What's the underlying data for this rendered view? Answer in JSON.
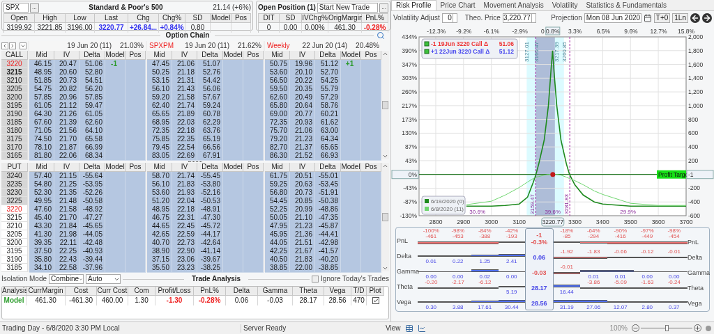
{
  "quote": {
    "symbol": "SPX",
    "browse": "...",
    "title": "Standard & Poor's 500",
    "iv": "21.14 (+6%)",
    "columns": [
      "Open",
      "High",
      "Low",
      "Last",
      "Chg",
      "Chg%",
      "SD",
      "Model",
      "Pos"
    ],
    "values": [
      {
        "text": "3199.92"
      },
      {
        "text": "3221.85"
      },
      {
        "text": "3196.00"
      },
      {
        "text": "3220.77",
        "color": "#3333ee"
      },
      {
        "text": "+26.84...",
        "color": "#3333ee"
      },
      {
        "text": "+0.84%",
        "color": "#3333ee"
      },
      {
        "text": "0.80"
      }
    ]
  },
  "open_position": {
    "title": "Open Position (1)",
    "trade": "Start New Trade",
    "browse": "...",
    "columns": [
      "DIT",
      "SD",
      "IVChg%",
      "OrigMargin",
      "PnL%"
    ],
    "values": [
      {
        "text": "0"
      },
      {
        "text": "0.00"
      },
      {
        "text": "0.00%"
      },
      {
        "text": "461.30"
      },
      {
        "text": "-0.28%",
        "color": "#ee2222"
      }
    ]
  },
  "option_chain": {
    "title": "Option Chain",
    "expirations": [
      {
        "date": "19 Jun 20 (11)",
        "iv": "21.03%"
      },
      {
        "tag": "SPXPM",
        "date": "19 Jun 20 (11)",
        "iv": "21.62%"
      },
      {
        "tag": "Weekly",
        "date": "22 Jun 20 (14)",
        "iv": "20.48%"
      }
    ],
    "calls": {
      "header": "CALL",
      "columns": [
        "Mid",
        "IV",
        "Delta",
        "Model",
        "Pos",
        "Mid",
        "IV",
        "Delta",
        "Model",
        "Pos",
        "Mid",
        "IV",
        "Delta",
        "Model",
        "Pos"
      ],
      "rows": [
        {
          "strike": "3220",
          "itm": true,
          "atm": true,
          "bold": false,
          "cells": [
            "46.15",
            "20.47",
            "51.06",
            "-1",
            "",
            "47.45",
            "21.06",
            "51.07",
            "",
            "",
            "50.75",
            "19.96",
            "51.12",
            "+1",
            ""
          ]
        },
        {
          "strike": "3215",
          "itm": true,
          "atm": false,
          "bold": true,
          "cells": [
            "48.95",
            "20.60",
            "52.80",
            "",
            "",
            "50.25",
            "21.18",
            "52.76",
            "",
            "",
            "53.60",
            "20.10",
            "52.70",
            "",
            ""
          ]
        },
        {
          "strike": "3210",
          "itm": true,
          "atm": false,
          "bold": false,
          "cells": [
            "51.85",
            "20.73",
            "54.51",
            "",
            "",
            "53.15",
            "21.31",
            "54.42",
            "",
            "",
            "56.50",
            "20.22",
            "54.25",
            "",
            ""
          ]
        },
        {
          "strike": "3205",
          "itm": true,
          "atm": false,
          "bold": false,
          "cells": [
            "54.75",
            "20.82",
            "56.20",
            "",
            "",
            "56.10",
            "21.43",
            "56.06",
            "",
            "",
            "59.50",
            "20.35",
            "55.79",
            "",
            ""
          ]
        },
        {
          "strike": "3200",
          "itm": true,
          "atm": false,
          "bold": false,
          "cells": [
            "57.85",
            "20.96",
            "57.85",
            "",
            "",
            "59.20",
            "21.58",
            "57.67",
            "",
            "",
            "62.60",
            "20.49",
            "57.29",
            "",
            ""
          ]
        },
        {
          "strike": "3195",
          "itm": true,
          "atm": false,
          "bold": false,
          "cells": [
            "61.05",
            "21.12",
            "59.47",
            "",
            "",
            "62.40",
            "21.74",
            "59.24",
            "",
            "",
            "65.80",
            "20.64",
            "58.76",
            "",
            ""
          ]
        },
        {
          "strike": "3190",
          "itm": true,
          "atm": false,
          "bold": false,
          "cells": [
            "64.30",
            "21.26",
            "61.05",
            "",
            "",
            "65.65",
            "21.89",
            "60.78",
            "",
            "",
            "69.00",
            "20.77",
            "60.21",
            "",
            ""
          ]
        },
        {
          "strike": "3185",
          "itm": true,
          "atm": false,
          "bold": false,
          "cells": [
            "67.60",
            "21.39",
            "62.60",
            "",
            "",
            "68.95",
            "22.03",
            "62.29",
            "",
            "",
            "72.35",
            "20.93",
            "61.62",
            "",
            ""
          ]
        },
        {
          "strike": "3180",
          "itm": true,
          "atm": false,
          "bold": false,
          "cells": [
            "71.05",
            "21.56",
            "64.10",
            "",
            "",
            "72.35",
            "22.18",
            "63.76",
            "",
            "",
            "75.70",
            "21.06",
            "63.00",
            "",
            ""
          ]
        },
        {
          "strike": "3175",
          "itm": true,
          "atm": false,
          "bold": false,
          "cells": [
            "74.50",
            "21.70",
            "65.58",
            "",
            "",
            "75.85",
            "22.35",
            "65.19",
            "",
            "",
            "79.20",
            "21.23",
            "64.34",
            "",
            ""
          ]
        },
        {
          "strike": "3170",
          "itm": true,
          "atm": false,
          "bold": false,
          "cells": [
            "78.10",
            "21.87",
            "66.99",
            "",
            "",
            "79.45",
            "22.54",
            "66.56",
            "",
            "",
            "82.70",
            "21.37",
            "65.65",
            "",
            ""
          ]
        },
        {
          "strike": "3165",
          "itm": true,
          "atm": false,
          "bold": false,
          "cells": [
            "81.80",
            "22.06",
            "68.34",
            "",
            "",
            "83.05",
            "22.69",
            "67.91",
            "",
            "",
            "86.30",
            "21.52",
            "66.93",
            "",
            ""
          ]
        }
      ]
    },
    "puts": {
      "header": "PUT",
      "columns": [
        "Mid",
        "IV",
        "Delta",
        "Model",
        "Pos",
        "Mid",
        "IV",
        "Delta",
        "Model",
        "Pos",
        "Mid",
        "IV",
        "Delta",
        "Model",
        "Pos"
      ],
      "rows": [
        {
          "strike": "3240",
          "itm": true,
          "atm": false,
          "bold": false,
          "cells": [
            "57.40",
            "21.15",
            "-55.64",
            "",
            "",
            "58.70",
            "21.74",
            "-55.45",
            "",
            "",
            "61.75",
            "20.51",
            "-55.01",
            "",
            ""
          ]
        },
        {
          "strike": "3235",
          "itm": true,
          "atm": false,
          "bold": false,
          "cells": [
            "54.80",
            "21.25",
            "-53.95",
            "",
            "",
            "56.10",
            "21.83",
            "-53.80",
            "",
            "",
            "59.25",
            "20.63",
            "-53.45",
            "",
            ""
          ]
        },
        {
          "strike": "3230",
          "itm": true,
          "atm": false,
          "bold": false,
          "cells": [
            "52.30",
            "21.35",
            "-52.26",
            "",
            "",
            "53.60",
            "21.93",
            "-52.16",
            "",
            "",
            "56.80",
            "20.73",
            "-51.91",
            "",
            ""
          ]
        },
        {
          "strike": "3225",
          "itm": true,
          "atm": false,
          "bold": false,
          "cells": [
            "49.95",
            "21.48",
            "-50.58",
            "",
            "",
            "51.20",
            "22.04",
            "-50.53",
            "",
            "",
            "54.45",
            "20.85",
            "-50.38",
            "",
            ""
          ]
        },
        {
          "strike": "3220",
          "itm": false,
          "atm": true,
          "bold": false,
          "cells": [
            "47.60",
            "21.58",
            "-48.92",
            "",
            "",
            "48.95",
            "22.18",
            "-48.91",
            "",
            "",
            "52.25",
            "20.99",
            "-48.86",
            "",
            ""
          ]
        },
        {
          "strike": "3215",
          "itm": false,
          "atm": false,
          "bold": false,
          "cells": [
            "45.40",
            "21.70",
            "-47.27",
            "",
            "",
            "46.75",
            "22.31",
            "-47.30",
            "",
            "",
            "50.05",
            "21.10",
            "-47.35",
            "",
            ""
          ]
        },
        {
          "strike": "3210",
          "itm": false,
          "atm": false,
          "bold": false,
          "cells": [
            "43.30",
            "21.84",
            "-45.65",
            "",
            "",
            "44.65",
            "22.45",
            "-45.72",
            "",
            "",
            "47.95",
            "21.23",
            "-45.87",
            "",
            ""
          ]
        },
        {
          "strike": "3205",
          "itm": false,
          "atm": false,
          "bold": false,
          "cells": [
            "41.30",
            "21.98",
            "-44.05",
            "",
            "",
            "42.65",
            "22.59",
            "-44.17",
            "",
            "",
            "45.95",
            "21.36",
            "-44.41",
            "",
            ""
          ]
        },
        {
          "strike": "3200",
          "itm": false,
          "atm": false,
          "bold": false,
          "cells": [
            "39.35",
            "22.11",
            "-42.48",
            "",
            "",
            "40.70",
            "22.73",
            "-42.64",
            "",
            "",
            "44.05",
            "21.51",
            "-42.98",
            "",
            ""
          ]
        },
        {
          "strike": "3195",
          "itm": false,
          "atm": false,
          "bold": false,
          "cells": [
            "37.50",
            "22.25",
            "-40.93",
            "",
            "",
            "38.90",
            "22.90",
            "-41.14",
            "",
            "",
            "42.25",
            "21.67",
            "-41.57",
            "",
            ""
          ]
        },
        {
          "strike": "3190",
          "itm": false,
          "atm": false,
          "bold": false,
          "cells": [
            "35.80",
            "22.43",
            "-39.44",
            "",
            "",
            "37.15",
            "23.06",
            "-39.67",
            "",
            "",
            "40.50",
            "21.83",
            "-40.20",
            "",
            ""
          ]
        },
        {
          "strike": "3185",
          "itm": false,
          "atm": false,
          "bold": false,
          "cells": [
            "34.10",
            "22.58",
            "-37.96",
            "",
            "",
            "35.50",
            "23.23",
            "-38.25",
            "",
            "",
            "38.85",
            "22.00",
            "-38.85",
            "",
            ""
          ]
        }
      ]
    }
  },
  "trade_analysis": {
    "title": "Trade Analysis",
    "isolation_label": "Isolation Mode",
    "mode": "Combine",
    "submode": "Auto",
    "ignore_label": "Ignore Today's Trades",
    "ignore_checked": false,
    "columns": [
      "Analysis",
      "CurrMargin",
      "Cost",
      "Curr Cost",
      "Com",
      "Profit/Loss",
      "PnL%",
      "Delta",
      "Gamma",
      "Theta",
      "Vega",
      "T/D",
      "Plot"
    ],
    "cells": [
      {
        "text": "Model",
        "color": "#2e9e2e"
      },
      {
        "text": "461.30"
      },
      {
        "text": "-461.30"
      },
      {
        "text": "460.00"
      },
      {
        "text": "1.30"
      },
      {
        "text": "-1.30",
        "color": "#ee2222"
      },
      {
        "text": "-0.28%",
        "color": "#ee2222"
      },
      {
        "text": "0.06"
      },
      {
        "text": "-0.03"
      },
      {
        "text": "28.17"
      },
      {
        "text": "28.56"
      },
      {
        "text": "470"
      }
    ],
    "plot_checked": true
  },
  "risk": {
    "tabs": [
      {
        "label": "Risk Profile",
        "selected": true
      },
      {
        "label": "Price Chart",
        "selected": false
      },
      {
        "label": "Movement Analysis",
        "selected": false
      },
      {
        "label": "Volatility",
        "selected": false
      },
      {
        "label": "Statistics & Fundamentals",
        "selected": false
      }
    ],
    "volatility_label": "Volatility Adjust",
    "volatility": "0",
    "theo_label": "Theo. Price",
    "theo": "3,220.77",
    "projection_label": "Projection",
    "projection": "Mon 08 Jun 2020",
    "t0": "T+0",
    "ln": "1Ln",
    "legend": [
      {
        "text": "-1 19Jun 3220 Call Δ",
        "value": "51.06",
        "color": "#ee3333"
      },
      {
        "text": "+1 22Jun 3220 Call Δ",
        "value": "51.12",
        "color": "#4444ee"
      }
    ],
    "move_axis": [
      "-12.3%",
      "-9.2%",
      "-6.1%",
      "-2.9%",
      "0",
      "3.3%",
      "6.5%",
      "9.6%",
      "12.7%",
      "15.8%"
    ],
    "current_move": "0.8%",
    "range_tags": [
      "3127.01",
      "3160.47",
      "3217.39",
      "3260.85"
    ],
    "percent_ticks": [
      "434%",
      "390%",
      "347%",
      "303%",
      "260%",
      "217%",
      "173%",
      "130%",
      "87%",
      "43%",
      "0%",
      "-43%",
      "-87%",
      "-130%"
    ],
    "profit_target": "Profit Targe",
    "zero_marker": "-1",
    "chart_data": {
      "type": "line",
      "grid": true,
      "legend": true,
      "x": [
        2910,
        3000,
        3050,
        3100,
        3130,
        3150,
        3160,
        3170,
        3190,
        3205,
        3215,
        3220,
        3225,
        3235,
        3250,
        3270,
        3281,
        3300,
        3330,
        3370,
        3400,
        3500,
        3600,
        3700
      ],
      "series": [
        {
          "name": "6/19/2020 (0)",
          "color": "#1e8a1e",
          "values": [
            -460,
            -460,
            -450,
            -430,
            -330,
            -120,
            0,
            150,
            500,
            1000,
            1550,
            1800,
            1500,
            1000,
            500,
            150,
            0,
            -150,
            -300,
            -400,
            -430,
            -460,
            -460,
            -460
          ]
        },
        {
          "name": "6/8/2020 (11)",
          "color": "#6fd66f",
          "values": [
            -440,
            -390,
            -300,
            -190,
            -110,
            -60,
            -40,
            -30,
            -10,
            0,
            0,
            0,
            0,
            0,
            -10,
            -40,
            -60,
            -90,
            -150,
            -240,
            -290,
            -420,
            -450,
            -450
          ]
        }
      ],
      "ref_lines": [
        {
          "axis": "y",
          "value": 0,
          "color": "#2a7a2a"
        },
        {
          "axis": "x",
          "value": 3159.47,
          "label": "3159.47"
        },
        {
          "axis": "x",
          "value": 3281.83,
          "label": "3281.83"
        }
      ],
      "xlim": [
        2740,
        3700
      ],
      "ylim": [
        -600,
        2000
      ],
      "xticks": [
        2800,
        2900,
        3000,
        3100,
        3300,
        3400,
        3500,
        3600,
        3700
      ],
      "yticks": [
        -600,
        -400,
        -200,
        200,
        400,
        600,
        800,
        {
          "value": 1000,
          "label": "1,000"
        },
        {
          "value": 1200,
          "label": "1,200"
        },
        {
          "value": 1400,
          "label": "1,400"
        },
        {
          "value": 1600,
          "label": "1,600"
        },
        {
          "value": 1800,
          "label": "1,800"
        },
        {
          "value": 2000,
          "label": "2,000"
        }
      ]
    },
    "current_price": "3220.77",
    "probabilities": [
      "30.6%",
      "39.6%",
      "29.9%"
    ],
    "greeks": {
      "rows": [
        {
          "label": "PnL",
          "right_label": "PnL",
          "cells": [
            [
              "-100%",
              "-461"
            ],
            [
              "-98%",
              "-453"
            ],
            [
              "-84%",
              "-388"
            ],
            [
              "-42%",
              "-193"
            ],
            [
              "-18%",
              "-85"
            ],
            [
              "-64%",
              "-294"
            ],
            [
              "-90%",
              "-416"
            ],
            [
              "-97%",
              "-449"
            ],
            [
              "-98%",
              "-454"
            ]
          ],
          "center": [
            "-1",
            "-0.3%"
          ]
        },
        {
          "label": "Delta",
          "right_label": "Delta",
          "cells": [
            [
              "0.01"
            ],
            [
              "0.22"
            ],
            [
              "1.25"
            ],
            [
              "2.41"
            ],
            [
              "-1.92"
            ],
            [
              "-1.83"
            ],
            [
              "-0.66"
            ],
            [
              "-0.12"
            ],
            [
              "-0.01"
            ]
          ],
          "center": [
            "0.06"
          ]
        },
        {
          "label": "Gamma",
          "right_label": "Gamma",
          "cells": [
            [
              "0.00"
            ],
            [
              "0.00"
            ],
            [
              "0.02"
            ],
            [
              "0.00"
            ],
            [
              "-0.01"
            ],
            [
              "0.01"
            ],
            [
              "0.01"
            ],
            [
              "0.00"
            ],
            [
              "0.00"
            ]
          ],
          "center": [
            "-0.03"
          ]
        },
        {
          "label": "Theta",
          "right_label": "Theta",
          "cells": [
            [
              "-0.20"
            ],
            [
              "-2.17"
            ],
            [
              "-6.12"
            ],
            [
              "5.19"
            ],
            [
              "16.44"
            ],
            [
              "-3.86"
            ],
            [
              "-5.09"
            ],
            [
              "-1.63"
            ],
            [
              "-0.24"
            ]
          ],
          "center": [
            "28.17"
          ]
        },
        {
          "label": "Vega",
          "right_label": "Vega",
          "cells": [
            [
              "0.30"
            ],
            [
              "3.88"
            ],
            [
              "17.61"
            ],
            [
              "30.44"
            ],
            [
              "31.19"
            ],
            [
              "27.06"
            ],
            [
              "12.07"
            ],
            [
              "2.80"
            ],
            [
              "0.37"
            ]
          ],
          "center": [
            "28.56"
          ]
        }
      ]
    }
  },
  "status": {
    "left": "Trading Day - 6/8/2020 3:30 PM Local",
    "middle": "Server Ready",
    "view": "View",
    "zoom": "100%",
    "zoom_slider": {
      "level": 0.5
    }
  }
}
